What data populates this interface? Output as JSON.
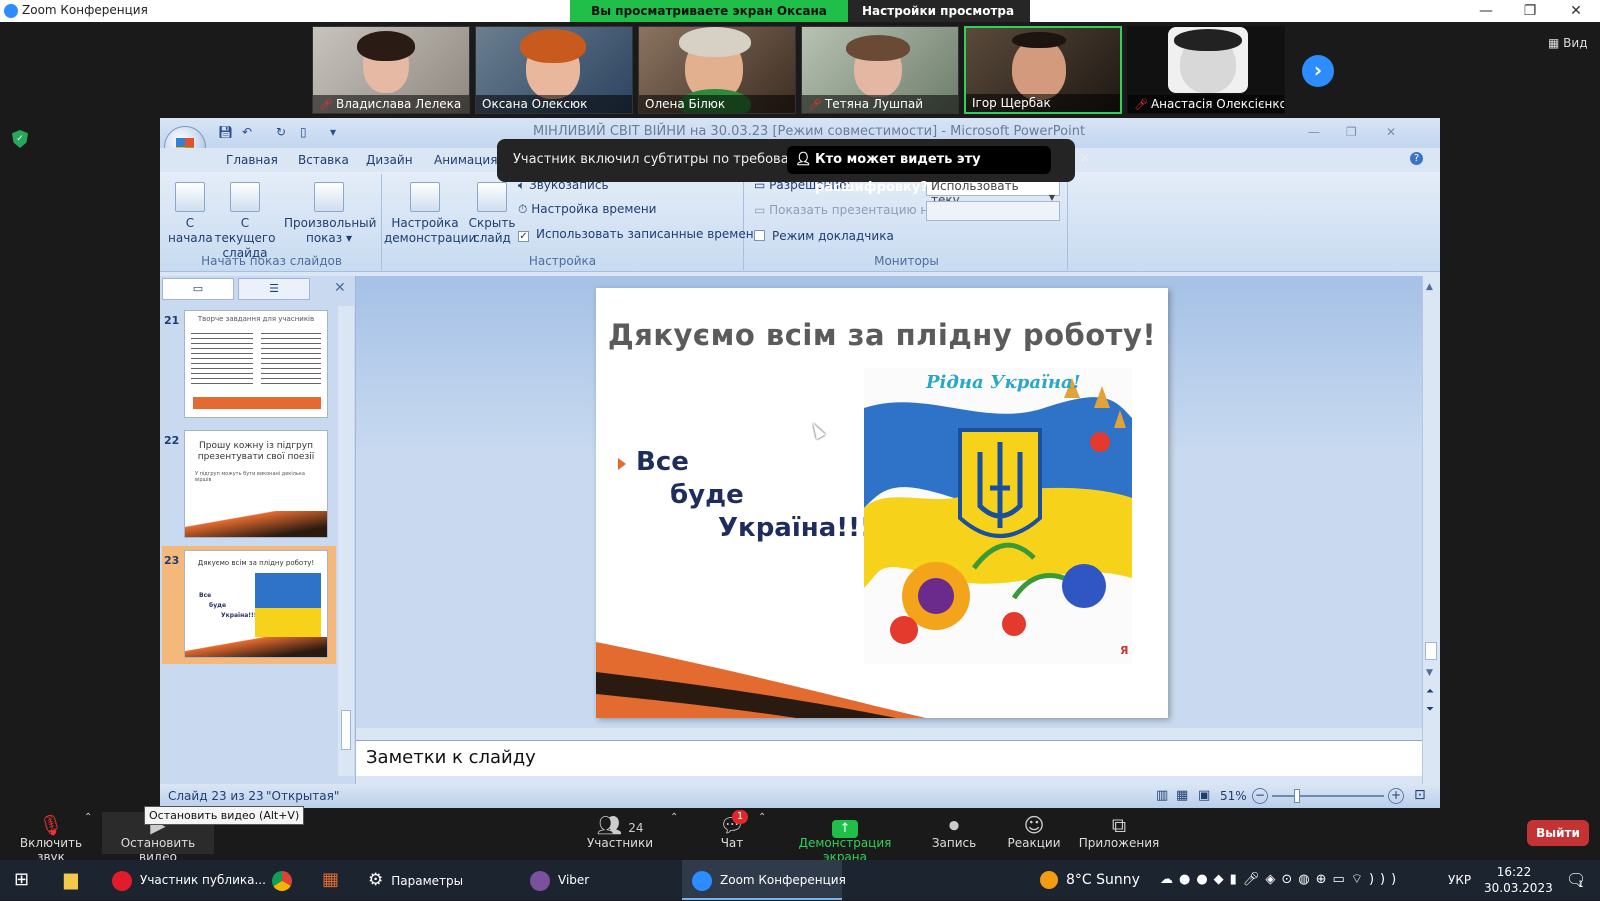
{
  "window": {
    "title": "Zoom Конференция",
    "min": "—",
    "max": "❐",
    "close": "✕"
  },
  "share_banner": {
    "viewing": "Вы просматриваете экран Оксана Олексюк",
    "view_settings": "Настройки просмотра",
    "chev": "⌄"
  },
  "participants": [
    {
      "name": "Владислава Лелека",
      "muted": true
    },
    {
      "name": "Оксана Олексюк",
      "muted": false
    },
    {
      "name": "Олена Білюк",
      "muted": false
    },
    {
      "name": "Тетяна Лушпай",
      "muted": true
    },
    {
      "name": "Ігор Щербак",
      "muted": false
    },
    {
      "name": "Анастасія Олексієнко",
      "muted": true
    }
  ],
  "next_icon": "›",
  "view_label": "Вид",
  "ppt": {
    "title": "МІНЛИВИЙ СВІТ ВІЙНИ на 30.03.23 [Режим совместимости] - Microsoft PowerPoint",
    "tabs": [
      "Главная",
      "Вставка",
      "Дизайн",
      "Анимация"
    ],
    "ribbon": {
      "group1": {
        "label": "Начать показ слайдов",
        "btn1": "С начала",
        "btn2": "С текущего слайда",
        "btn3": "Произвольный показ"
      },
      "group2": {
        "label": "Настройка",
        "btn1": "Настройка демонстрации",
        "btn2": "Скрыть слайд",
        "rows": [
          "Звукозапись",
          "Настройка времени",
          "Использовать записанные времена"
        ]
      },
      "group3": {
        "label": "Мониторы",
        "resolution": "Разрешение:",
        "resolution_value": "Использовать теку...",
        "show_on": "Показать презентацию на:",
        "presenter": "Режим докладчика"
      }
    },
    "thumbs": [
      {
        "num": "21",
        "title": "Творче завдання для учасників"
      },
      {
        "num": "22",
        "title": "Прошу кожну із підгруп презентувати свої поезії",
        "body": "У підгруп можуть бути виконані декілька віршів"
      },
      {
        "num": "23",
        "title": "Дякуємо всім за плідну роботу!",
        "b1": "Все",
        "b2": "буде",
        "b3": "Україна!!!"
      }
    ],
    "slide": {
      "title": "Дякуємо всім за плідну роботу!",
      "line1": "Все",
      "line2": "буде",
      "line3": "Україна!!!",
      "img_caption": "Рідна Україна!",
      "img_sig": "Я"
    },
    "notes": "Заметки к слайду",
    "status": {
      "slide": "Слайд 23 из 23",
      "theme": "\"Открытая\"",
      "zoom": "51%"
    }
  },
  "captions_popup": {
    "text": "Участник включил субтитры по требованию",
    "button": "Кто может видеть эту расшифровку?",
    "close": "×"
  },
  "toolbar": {
    "unmute": "Включить звук",
    "stop_video": "Остановить видео",
    "tooltip": "Остановить видео (Alt+V)",
    "participants": "Участники",
    "participants_count": "24",
    "chat": "Чат",
    "chat_badge": "1",
    "share": "Демонстрация экрана",
    "record": "Запись",
    "reactions": "Реакции",
    "apps": "Приложения",
    "leave": "Выйти"
  },
  "taskbar": {
    "opera": "Участник публика...",
    "settings": "Параметры",
    "viber": "Viber",
    "zoom": "Zoom Конференция",
    "weather": "8°C  Sunny",
    "lang": "УКР",
    "time": "16:22",
    "date": "30.03.2023",
    "notif": "1"
  },
  "colors": {
    "accent": "#2d8cff",
    "share_green": "#1fbf4a",
    "leave_red": "#c43333",
    "ppt_blue": "#1e3e70"
  }
}
